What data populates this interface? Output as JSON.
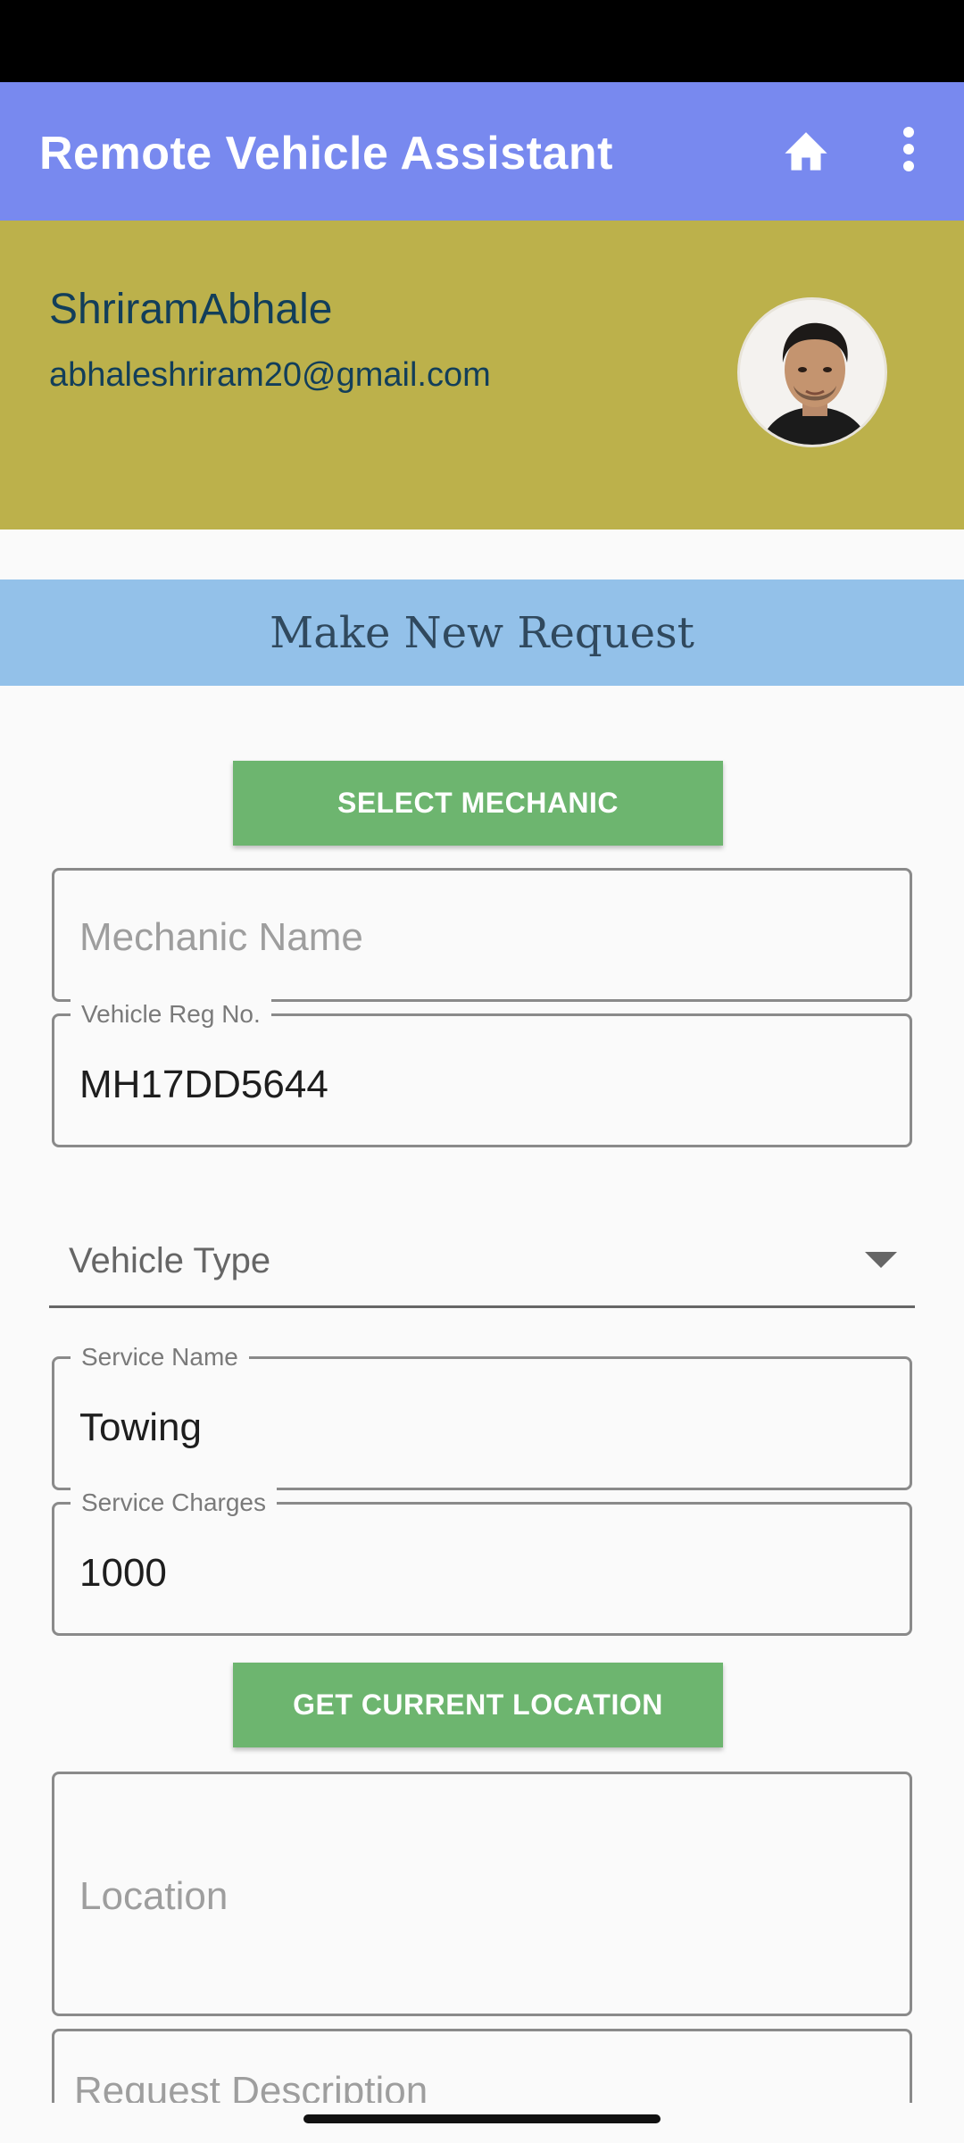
{
  "app_bar": {
    "title": "Remote Vehicle Assistant",
    "home_icon": "home-icon",
    "more_icon": "more-vert-icon",
    "color": "#7889ef"
  },
  "profile": {
    "name": "ShriramAbhale",
    "email": "abhaleshriram20@gmail.com",
    "background": "#bcb14b"
  },
  "request": {
    "title": "Make New Request",
    "banner_color": "#93c1e9"
  },
  "buttons": {
    "select_mechanic": "SELECT MECHANIC",
    "get_location": "GET CURRENT LOCATION",
    "color": "#6db56f"
  },
  "fields": {
    "mechanic_name": {
      "placeholder": "Mechanic Name",
      "value": ""
    },
    "vehicle_reg": {
      "label": "Vehicle Reg No.",
      "value": "MH17DD5644"
    },
    "vehicle_type": {
      "label": "Vehicle Type"
    },
    "service_name": {
      "label": "Service Name",
      "value": "Towing"
    },
    "service_charges": {
      "label": "Service Charges",
      "value": "1000"
    },
    "location": {
      "placeholder": "Location",
      "value": ""
    },
    "request_description": {
      "placeholder": "Request Description",
      "value": ""
    }
  }
}
